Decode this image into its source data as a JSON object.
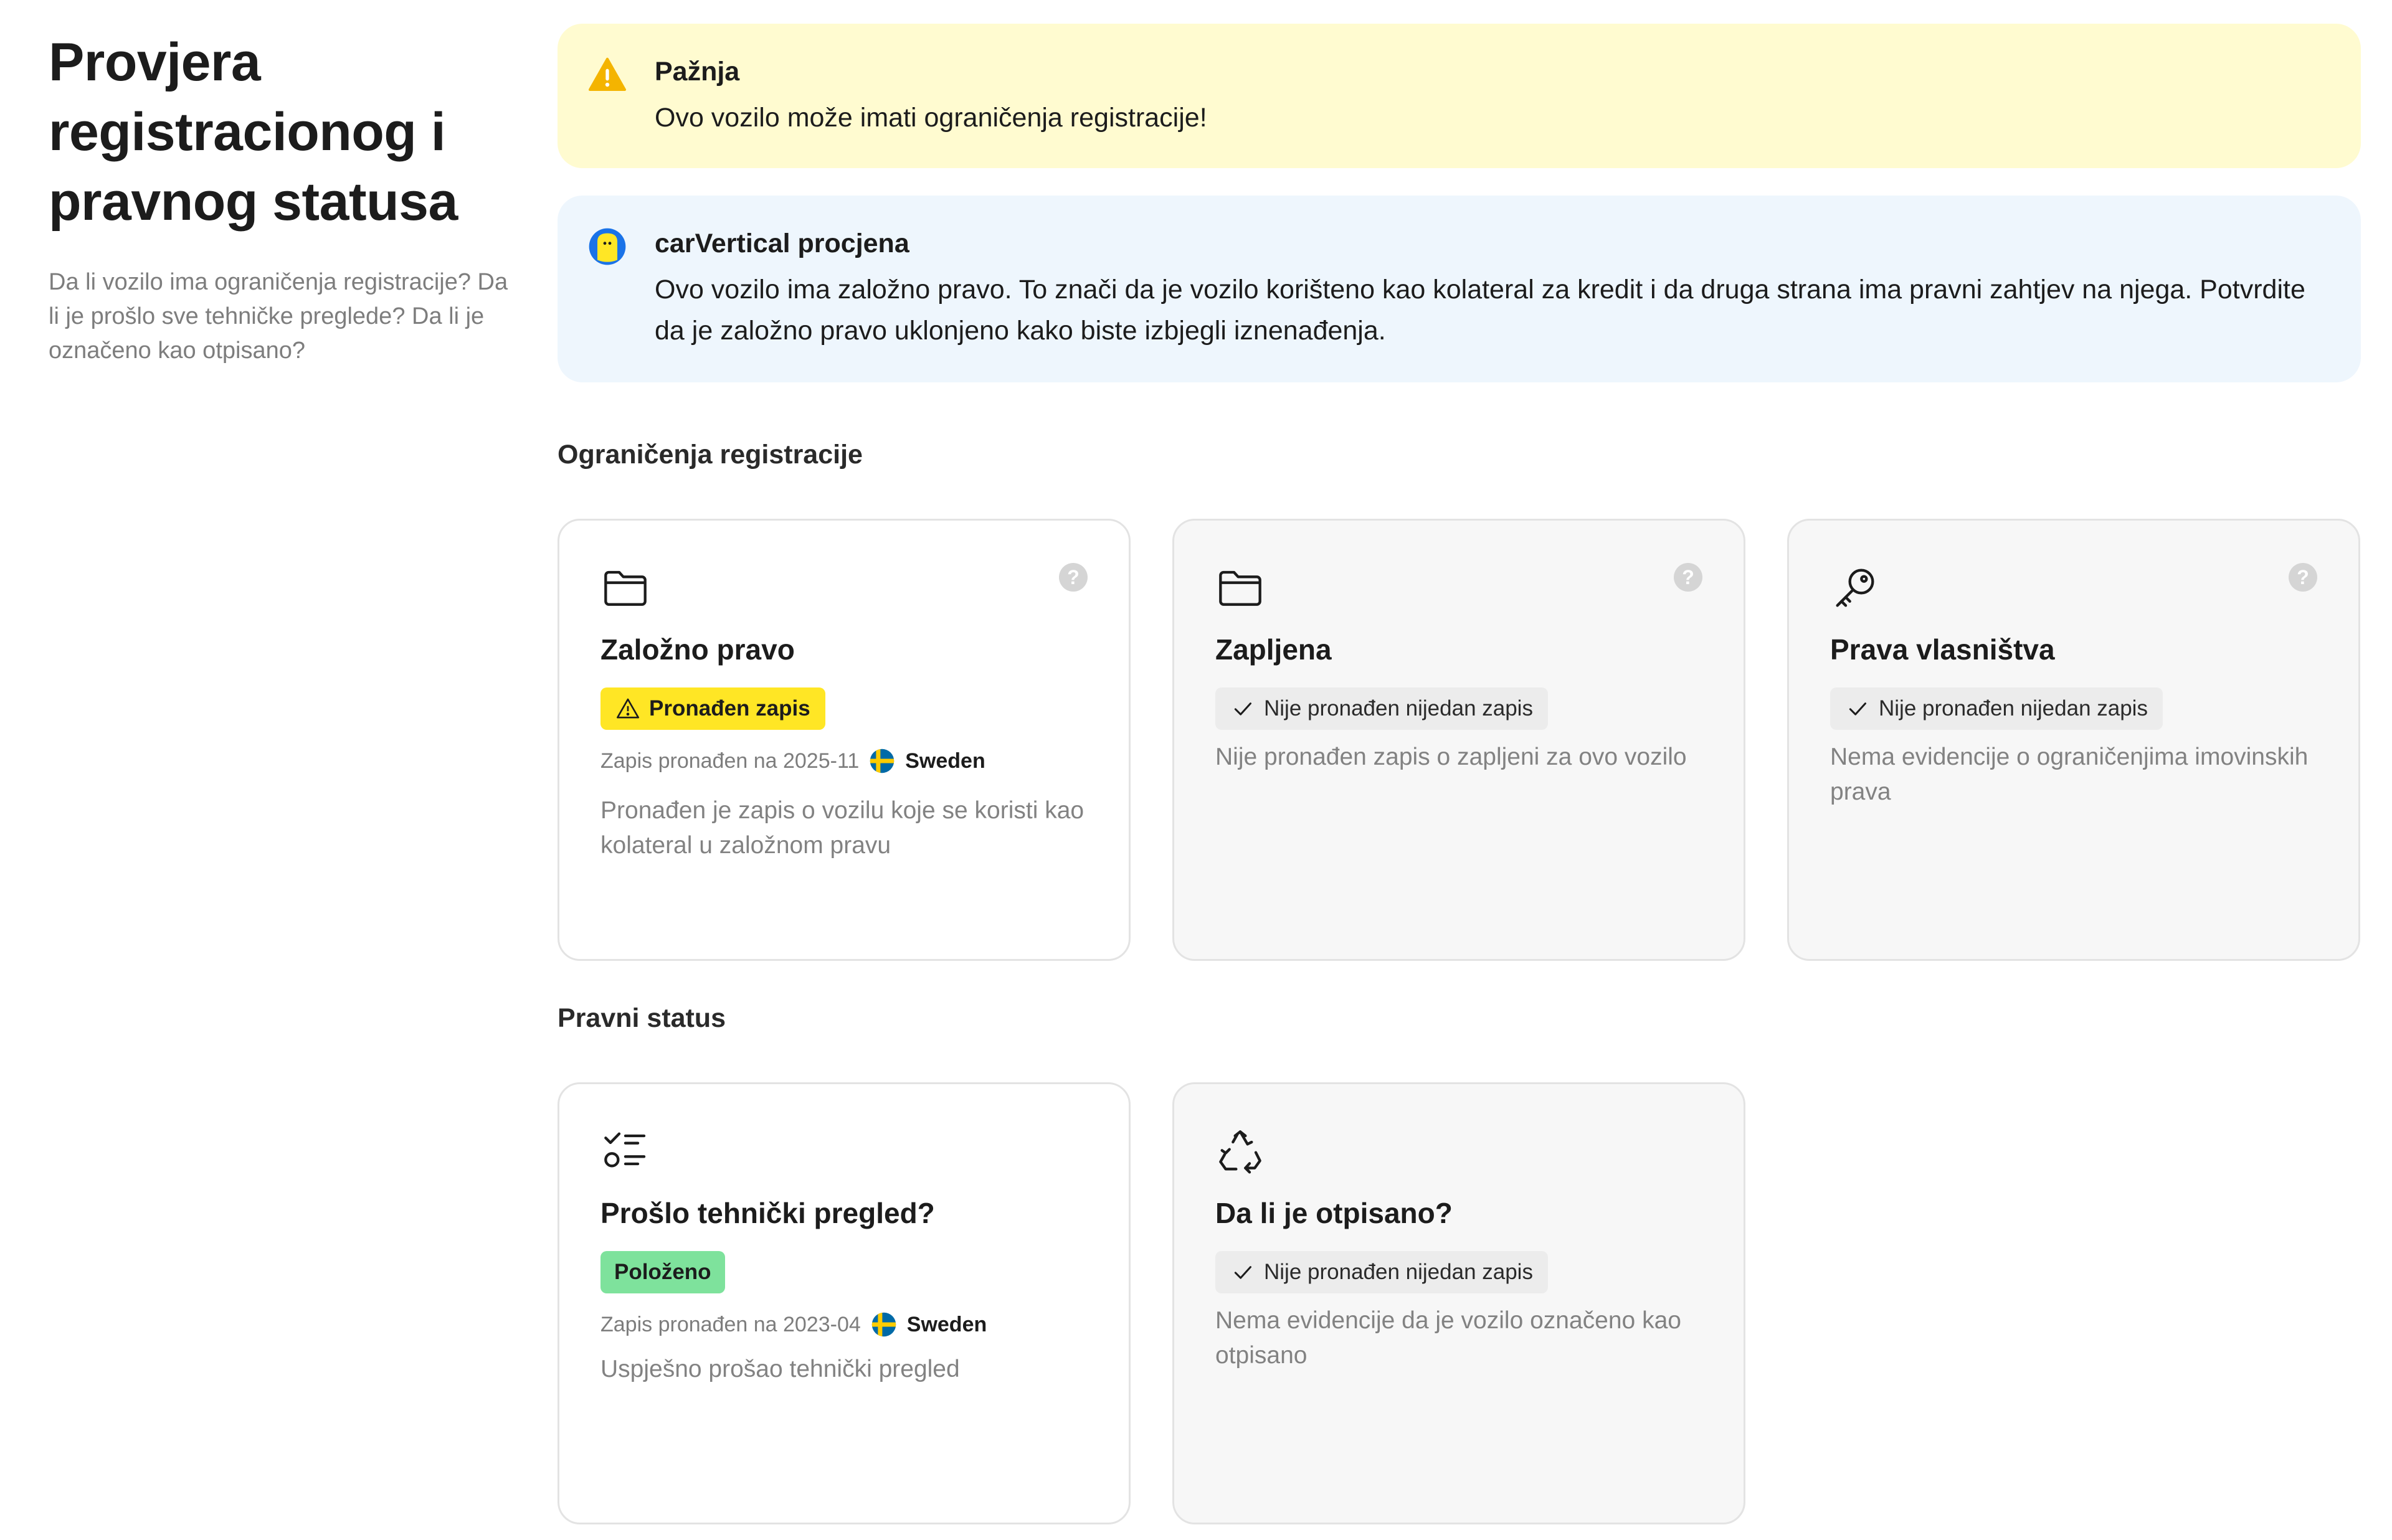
{
  "sidebar": {
    "title": "Provjera registracionog i pravnog statusa",
    "description": "Da li vozilo ima ograničenja registracije? Da li je prošlo sve tehničke preglede? Da li je označeno kao otpisano?"
  },
  "alerts": {
    "warning": {
      "title": "Pažnja",
      "text": "Ovo vozilo može imati ograničenja registracije!",
      "icon": "warning-triangle-icon",
      "color": "#fffbd0"
    },
    "assessment": {
      "title": "carVertical procjena",
      "text": "Ovo vozilo ima založno pravo. To znači da je vozilo korišteno kao kolateral za kredit i da druga strana ima pravni zahtjev na njega. Potvrdite da je založno pravo uklonjeno kako biste izbjegli iznenađenja.",
      "icon": "carvertical-mascot-icon",
      "color": "#eef6fd"
    }
  },
  "sections": {
    "restrictions": {
      "title": "Ograničenja registracije",
      "cards": [
        {
          "icon": "folder-icon",
          "title": "Založno pravo",
          "badge": "Pronađen zapis",
          "badge_color": "#ffe625",
          "record_text": "Zapis pronađen na 2025-11",
          "country": "Sweden",
          "description": "Pronađen je zapis o vozilu koje se koristi kao kolateral u založnom pravu"
        },
        {
          "icon": "folder-icon",
          "title": "Zapljena",
          "badge": "Nije pronađen nijedan zapis",
          "description": "Nije pronađen zapis o zapljeni za ovo vozilo"
        },
        {
          "icon": "key-icon",
          "title": "Prava vlasništva",
          "badge": "Nije pronađen nijedan zapis",
          "description": "Nema evidencije o ograničenjima imovinskih prava"
        }
      ]
    },
    "legal": {
      "title": "Pravni status",
      "cards": [
        {
          "icon": "checklist-icon",
          "title": "Prošlo tehnički pregled?",
          "badge": "Položeno",
          "badge_color": "#7ee29c",
          "record_text": "Zapis pronađen na 2023-04",
          "country": "Sweden",
          "description": "Uspješno prošao tehnički pregled"
        },
        {
          "icon": "recycle-icon",
          "title": "Da li je otpisano?",
          "badge": "Nije pronađen nijedan zapis",
          "description": "Nema evidencije da je vozilo označeno kao otpisano"
        }
      ]
    }
  },
  "help_icon_label": "?"
}
